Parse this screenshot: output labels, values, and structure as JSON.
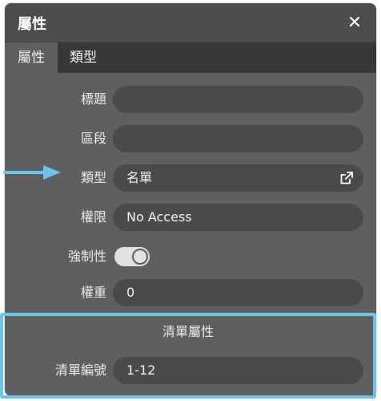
{
  "dialog": {
    "title": "屬性",
    "close_glyph": "✕"
  },
  "tabs": [
    {
      "label": "屬性",
      "active": true
    },
    {
      "label": "類型",
      "active": false
    }
  ],
  "fields": {
    "title": {
      "label": "標題",
      "value": ""
    },
    "section": {
      "label": "區段",
      "value": ""
    },
    "type": {
      "label": "類型",
      "value": "名單",
      "icon": "external-link-icon"
    },
    "permission": {
      "label": "權限",
      "value": "No Access"
    },
    "required": {
      "label": "強制性",
      "on": true
    },
    "weight": {
      "label": "權重",
      "value": "0"
    }
  },
  "list_properties": {
    "header": "清單屬性",
    "list_number": {
      "label": "清單編號",
      "value": "1-12"
    }
  },
  "colors": {
    "panel": "#5f5f5f",
    "titlebar": "#4d4d4d",
    "field": "#4a4a4a",
    "accent": "#6bc4ec"
  }
}
